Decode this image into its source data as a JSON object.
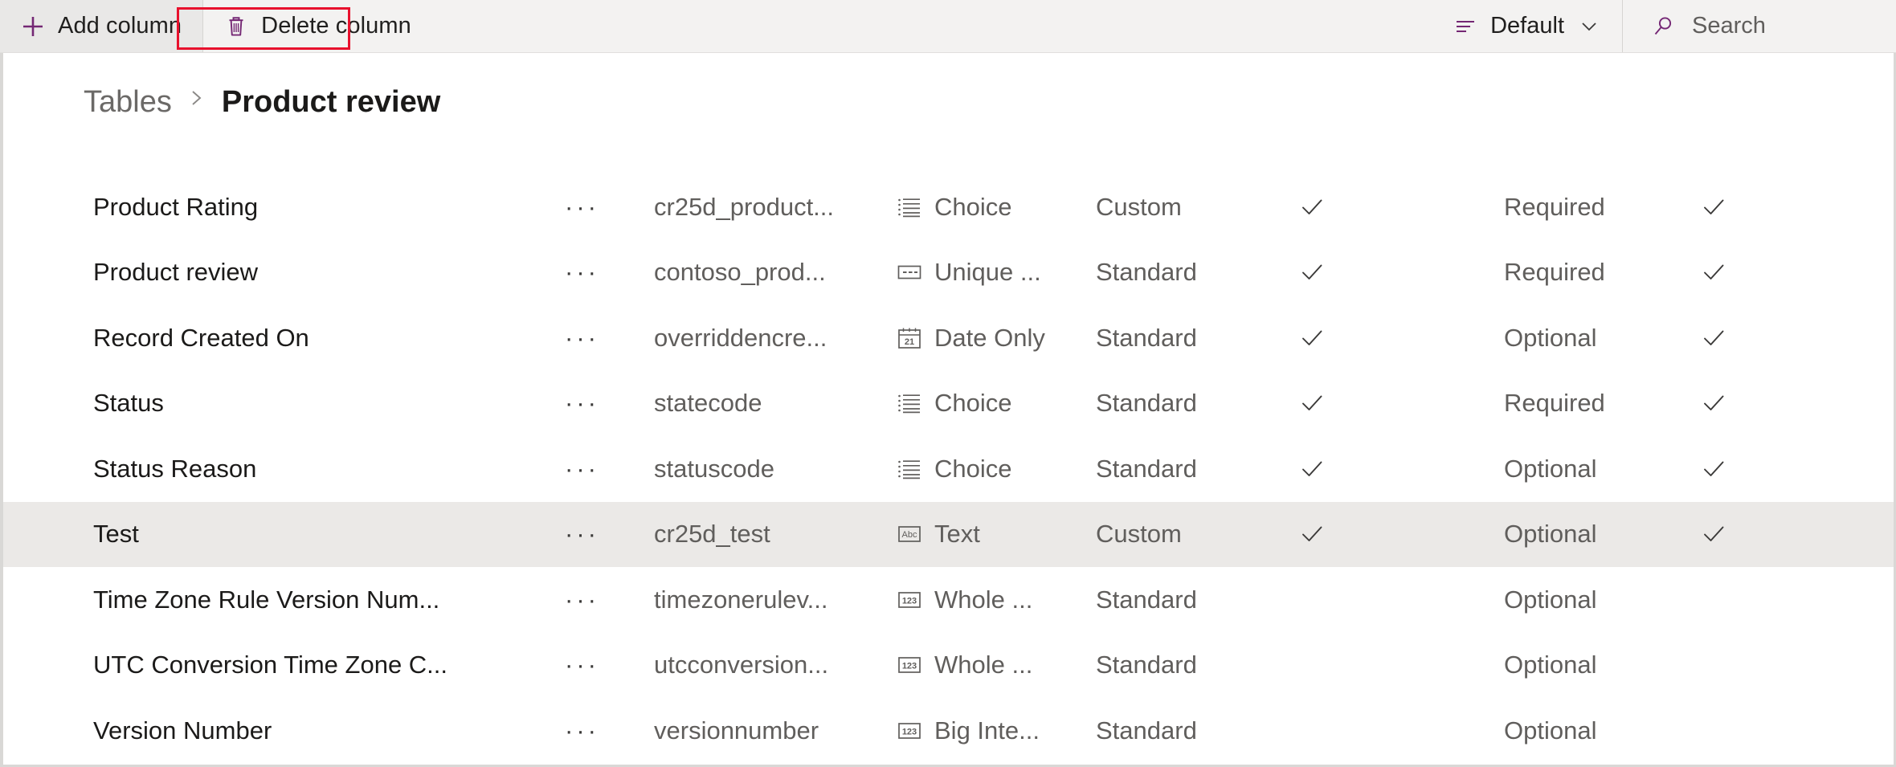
{
  "commandbar": {
    "add_column": {
      "label": "Add column",
      "icon": "plus-icon"
    },
    "delete_column": {
      "label": "Delete column",
      "icon": "trash-icon"
    },
    "view": {
      "label": "Default",
      "icon": "filter-list-icon",
      "chevron": "chevron-down-icon"
    },
    "search": {
      "label": "Search",
      "icon": "search-icon"
    },
    "annotation_color": "#e8112d",
    "accent_color": "#742774"
  },
  "breadcrumb": {
    "parent": "Tables",
    "separator": ">",
    "current": "Product review"
  },
  "grid": {
    "rows": [
      {
        "display_name": "Product Rating",
        "more": "···",
        "logical_name": "cr25d_product...",
        "data_type": "Choice",
        "type_icon": "choice-list-icon",
        "created_by": "Custom",
        "customizable": true,
        "requirement": "Required",
        "searchable": true,
        "selected": false
      },
      {
        "display_name": "Product review",
        "more": "···",
        "logical_name": "contoso_prod...",
        "data_type": "Unique ...",
        "type_icon": "unique-identifier-icon",
        "created_by": "Standard",
        "customizable": true,
        "requirement": "Required",
        "searchable": true,
        "selected": false
      },
      {
        "display_name": "Record Created On",
        "more": "···",
        "logical_name": "overriddencre...",
        "data_type": "Date Only",
        "type_icon": "calendar-icon",
        "created_by": "Standard",
        "customizable": true,
        "requirement": "Optional",
        "searchable": true,
        "selected": false
      },
      {
        "display_name": "Status",
        "more": "···",
        "logical_name": "statecode",
        "data_type": "Choice",
        "type_icon": "choice-list-icon",
        "created_by": "Standard",
        "customizable": true,
        "requirement": "Required",
        "searchable": true,
        "selected": false
      },
      {
        "display_name": "Status Reason",
        "more": "···",
        "logical_name": "statuscode",
        "data_type": "Choice",
        "type_icon": "choice-list-icon",
        "created_by": "Standard",
        "customizable": true,
        "requirement": "Optional",
        "searchable": true,
        "selected": false
      },
      {
        "display_name": "Test",
        "more": "···",
        "logical_name": "cr25d_test",
        "data_type": "Text",
        "type_icon": "text-abc-icon",
        "created_by": "Custom",
        "customizable": true,
        "requirement": "Optional",
        "searchable": true,
        "selected": true
      },
      {
        "display_name": "Time Zone Rule Version Num...",
        "more": "···",
        "logical_name": "timezonerulev...",
        "data_type": "Whole ...",
        "type_icon": "number-123-icon",
        "created_by": "Standard",
        "customizable": false,
        "requirement": "Optional",
        "searchable": false,
        "selected": false
      },
      {
        "display_name": "UTC Conversion Time Zone C...",
        "more": "···",
        "logical_name": "utcconversion...",
        "data_type": "Whole ...",
        "type_icon": "number-123-icon",
        "created_by": "Standard",
        "customizable": false,
        "requirement": "Optional",
        "searchable": false,
        "selected": false
      },
      {
        "display_name": "Version Number",
        "more": "···",
        "logical_name": "versionnumber",
        "data_type": "Big Inte...",
        "type_icon": "number-123-icon",
        "created_by": "Standard",
        "customizable": false,
        "requirement": "Optional",
        "searchable": false,
        "selected": false
      }
    ]
  }
}
